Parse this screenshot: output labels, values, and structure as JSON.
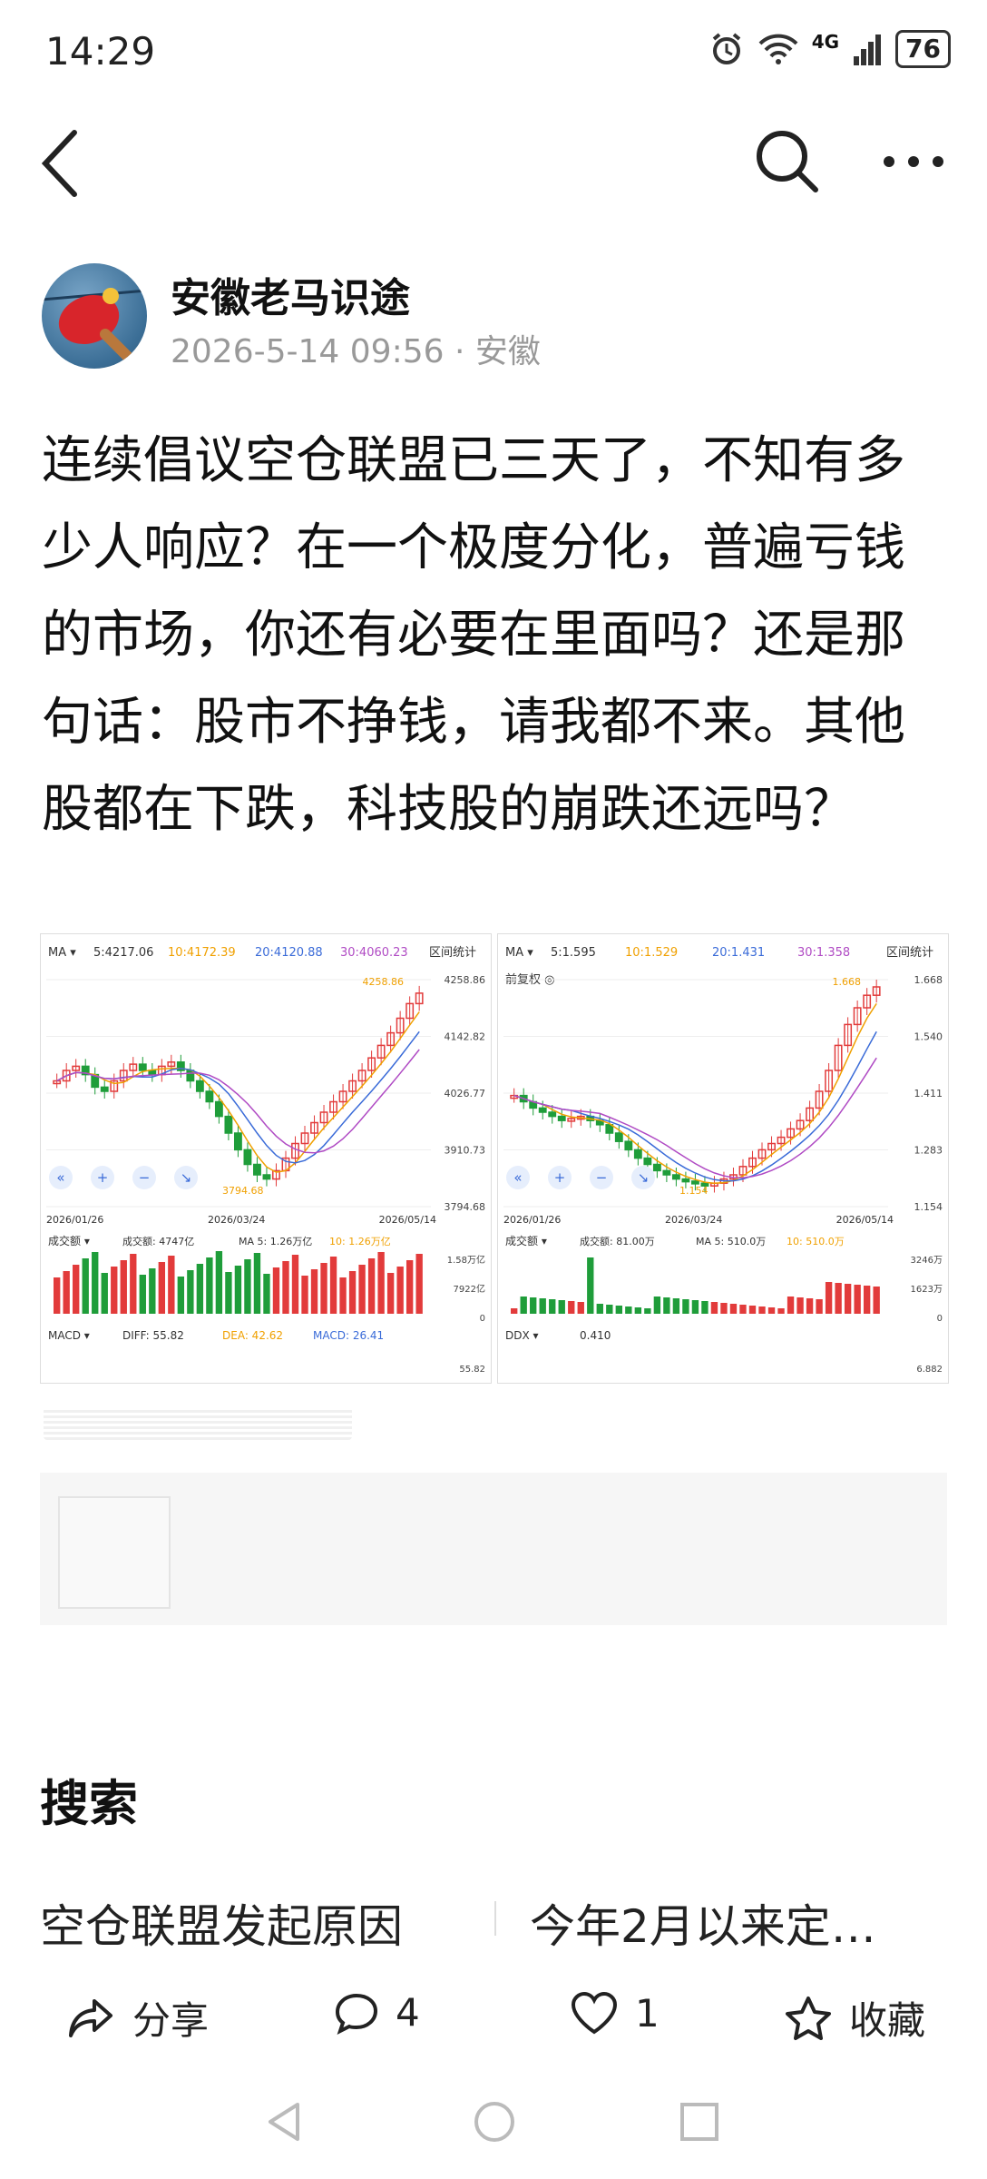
{
  "status_bar": {
    "time": "14:29",
    "signal": "4G",
    "battery": "76"
  },
  "author": {
    "name": "安徽老马识途",
    "meta": "2026-5-14 09:56 · 安徽"
  },
  "post": {
    "text": "连续倡议空仓联盟已三天了，不知有多少人响应？在一个极度分化，普遍亏钱的市场，你还有必要在里面吗？还是那句话：股市不挣钱，请我都不来。其他股都在下跌，科技股的崩跌还远吗？"
  },
  "charts": [
    {
      "ma_label": "MA ▾",
      "ma5": "5:4217.06",
      "ma10": "10:4172.39",
      "ma20": "20:4120.88",
      "ma30": "30:4060.23",
      "interval_btn": "区间统计",
      "price_labels": [
        "4258.86",
        "4142.82",
        "4026.77",
        "3910.73",
        "3794.68"
      ],
      "high_marker": "4258.86",
      "low_marker": "3794.68",
      "dates": [
        "2026/01/26",
        "2026/03/24",
        "2026/05/14"
      ],
      "vol_label": "成交额 ▾",
      "vol_value": "成交额: 4747亿",
      "vol_ma5": "MA 5: 1.26万亿",
      "vol_ma10": "10: 1.26万亿",
      "vol_axis": [
        "1.58万亿",
        "7922亿",
        "0"
      ],
      "ind_label": "MACD ▾",
      "ind_v1": "DIFF: 55.82",
      "ind_v2": "DEA: 42.62",
      "ind_v3": "MACD: 26.41",
      "ind_axis": "55.82",
      "trend": [
        0.55,
        0.6,
        0.62,
        0.58,
        0.52,
        0.5,
        0.55,
        0.6,
        0.63,
        0.6,
        0.58,
        0.62,
        0.64,
        0.6,
        0.55,
        0.5,
        0.45,
        0.38,
        0.3,
        0.22,
        0.15,
        0.1,
        0.08,
        0.12,
        0.18,
        0.25,
        0.3,
        0.35,
        0.4,
        0.45,
        0.5,
        0.55,
        0.6,
        0.66,
        0.72,
        0.78,
        0.85,
        0.92,
        0.97
      ]
    },
    {
      "ma_label": "MA ▾",
      "ma5": "5:1.595",
      "ma10": "10:1.529",
      "ma20": "20:1.431",
      "ma30": "30:1.358",
      "interval_btn": "区间统计",
      "fq_label": "前复权 ◎",
      "price_labels": [
        "1.668",
        "1.540",
        "1.411",
        "1.283",
        "1.154"
      ],
      "high_marker": "1.668",
      "low_marker": "1.154",
      "dates": [
        "2026/01/26",
        "2026/03/24",
        "2026/05/14"
      ],
      "vol_label": "成交额 ▾",
      "vol_value": "成交额: 81.00万",
      "vol_ma5": "MA 5: 510.0万",
      "vol_ma10": "10: 510.0万",
      "vol_axis": [
        "3246万",
        "1623万",
        "0"
      ],
      "ind_label": "DDX ▾",
      "ind_v1": "0.410",
      "ind_axis": "6.882",
      "trend": [
        0.48,
        0.45,
        0.42,
        0.4,
        0.38,
        0.36,
        0.37,
        0.38,
        0.36,
        0.34,
        0.3,
        0.26,
        0.22,
        0.18,
        0.15,
        0.12,
        0.1,
        0.08,
        0.07,
        0.06,
        0.05,
        0.06,
        0.08,
        0.1,
        0.14,
        0.18,
        0.22,
        0.25,
        0.28,
        0.32,
        0.36,
        0.42,
        0.5,
        0.6,
        0.72,
        0.82,
        0.9,
        0.96,
        1.0
      ]
    }
  ],
  "search": {
    "title": "搜索",
    "suggestions": [
      "空仓联盟发起原因",
      "今年2月以来定…"
    ]
  },
  "actions": {
    "share": "分享",
    "comment": "4",
    "like": "1",
    "favorite": "收藏"
  },
  "colors": {
    "up": "#e23b3b",
    "down": "#1f9d3a",
    "ma5": "#333333",
    "ma10": "#f0a000",
    "ma20": "#3a6bd8",
    "ma30": "#b04bc4"
  }
}
